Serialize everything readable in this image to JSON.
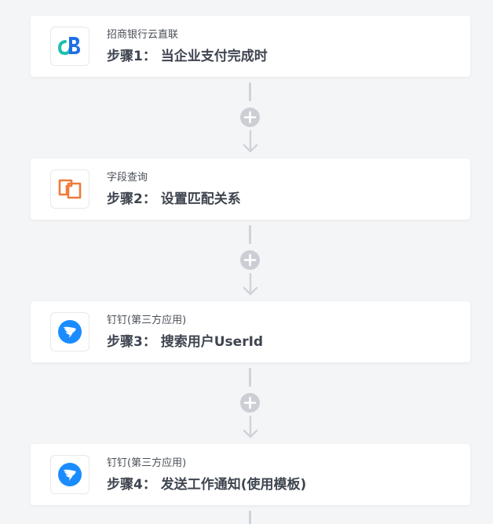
{
  "colors": {
    "background": "#f4f5f7",
    "card": "#ffffff",
    "connector": "#cbcfd5",
    "cmb_teal": "#1fbfb0",
    "cmb_blue": "#1f6fe5",
    "field_query_orange": "#ef7b3b",
    "dingtalk_blue": "#1a8cff"
  },
  "steps": [
    {
      "app": "招商银行云直联",
      "title": "步骤1： 当企业支付完成时",
      "icon": "cmb-bank-icon"
    },
    {
      "app": "字段查询",
      "title": "步骤2： 设置匹配关系",
      "icon": "field-query-icon"
    },
    {
      "app": "钉钉(第三方应用)",
      "title": "步骤3： 搜索用户UserId",
      "icon": "dingtalk-icon"
    },
    {
      "app": "钉钉(第三方应用)",
      "title": "步骤4： 发送工作通知(使用模板)",
      "icon": "dingtalk-icon"
    }
  ]
}
